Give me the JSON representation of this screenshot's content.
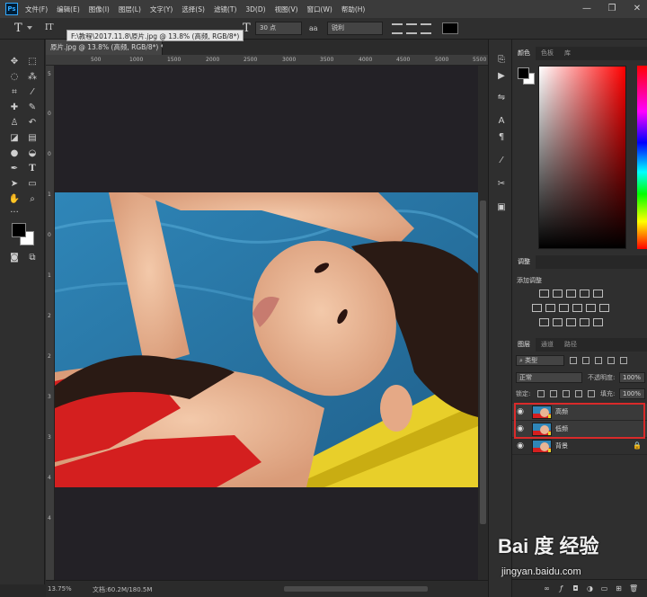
{
  "app": {
    "logo": "Ps"
  },
  "menu": [
    "文件(F)",
    "编辑(E)",
    "图像(I)",
    "图层(L)",
    "文字(Y)",
    "选择(S)",
    "滤镜(T)",
    "3D(D)",
    "视图(V)",
    "窗口(W)",
    "帮助(H)"
  ],
  "window_controls": {
    "minimize": "—",
    "restore": "❐",
    "close": "✕"
  },
  "options": {
    "tool_icon": "T",
    "orient_icon": "IT",
    "font_size_icon": "T",
    "font_size": "30 点",
    "aa_icon": "aa",
    "antialias": "锐利",
    "text_color": "#000000"
  },
  "document": {
    "tooltip": "F:\\教程\\2017.11.8\\原片.jpg @ 13.8% (高频, RGB/8*)",
    "tab_title": "原片.jpg @ 13.8% (高频, RGB/8*) *"
  },
  "rulers": {
    "top_labels": [
      "500",
      "1000",
      "1500",
      "2000",
      "2500",
      "3000",
      "3500",
      "4000",
      "4500",
      "5000",
      "5500",
      "6000"
    ],
    "left_labels": [
      "5",
      "0",
      "0",
      "1",
      "0",
      "1",
      "2",
      "2",
      "3",
      "3",
      "4",
      "4"
    ]
  },
  "status": {
    "zoom": "13.75%",
    "doc_info": "文档:60.2M/180.5M"
  },
  "panels": {
    "color_tabs": [
      "颜色",
      "色板",
      "库"
    ],
    "adjust_tab": "调整",
    "adjust_title": "添加调整",
    "layer_tabs": [
      "图层",
      "通道",
      "路径"
    ],
    "filter_kind": "类型",
    "blend_mode": "正常",
    "opacity_label": "不透明度:",
    "opacity_value": "100%",
    "lock_label": "锁定:",
    "fill_label": "填充:",
    "fill_value": "100%",
    "layers": [
      {
        "name": "高频",
        "locked": false
      },
      {
        "name": "低频",
        "locked": false
      },
      {
        "name": "背景",
        "locked": true
      }
    ]
  },
  "watermark": {
    "logo": "Bai 度 经验",
    "url": "jingyan.baidu.com"
  },
  "colors": {
    "highlight": "#d92a2a",
    "foreground": "#000000",
    "background": "#ffffff"
  }
}
